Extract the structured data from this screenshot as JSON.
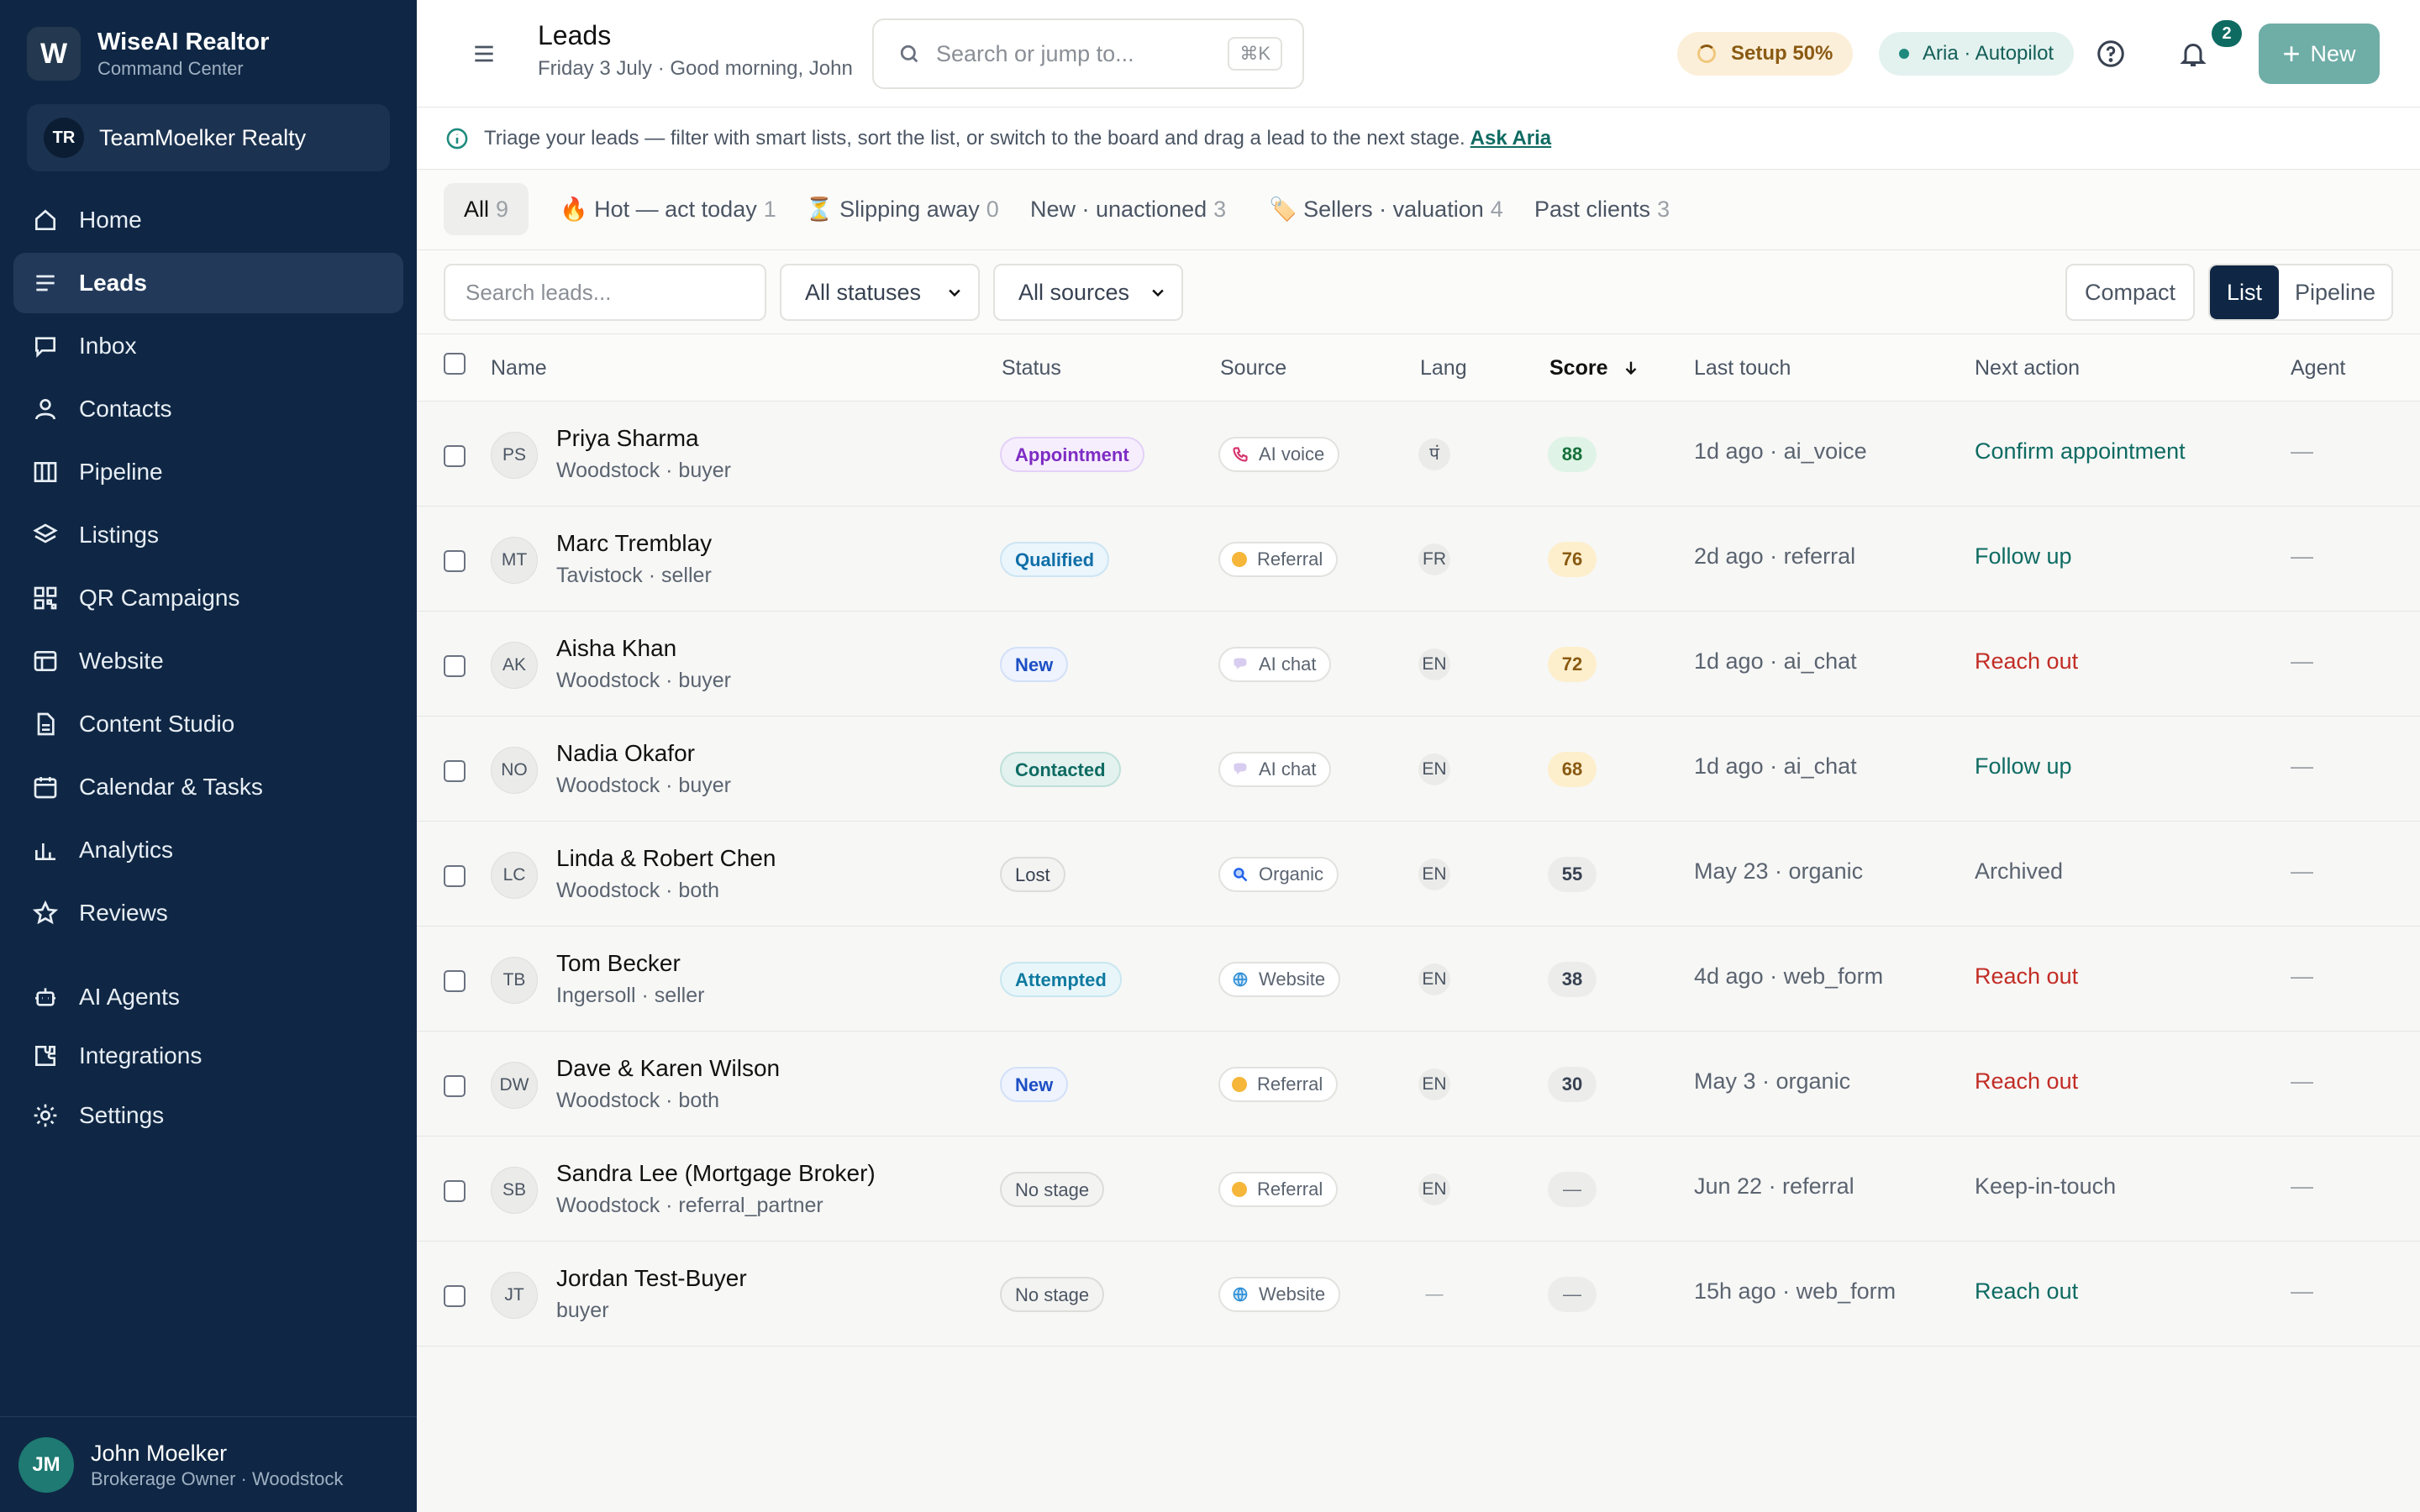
{
  "brand": {
    "logo_letter": "W",
    "name": "WiseAI Realtor",
    "subtitle": "Command Center"
  },
  "team": {
    "initials": "TR",
    "name": "TeamMoelker Realty"
  },
  "nav": [
    {
      "label": "Home",
      "icon": "home-icon"
    },
    {
      "label": "Leads",
      "icon": "list-icon",
      "active": true
    },
    {
      "label": "Inbox",
      "icon": "chat-icon"
    },
    {
      "label": "Contacts",
      "icon": "person-icon"
    },
    {
      "label": "Pipeline",
      "icon": "columns-icon"
    },
    {
      "label": "Listings",
      "icon": "layers-icon"
    },
    {
      "label": "QR Campaigns",
      "icon": "qr-icon"
    },
    {
      "label": "Website",
      "icon": "browser-icon"
    },
    {
      "label": "Content Studio",
      "icon": "document-icon"
    },
    {
      "label": "Calendar & Tasks",
      "icon": "calendar-icon"
    },
    {
      "label": "Analytics",
      "icon": "bar-chart-icon"
    },
    {
      "label": "Reviews",
      "icon": "star-icon"
    },
    {
      "label": "AI Agents",
      "icon": "robot-icon"
    },
    {
      "label": "Integrations",
      "icon": "puzzle-icon"
    },
    {
      "label": "Settings",
      "icon": "gear-icon"
    }
  ],
  "user": {
    "initials": "JM",
    "name": "John Moelker",
    "role": "Brokerage Owner · Woodstock"
  },
  "header": {
    "title": "Leads",
    "subtitle": "Friday 3 July · Good morning, John",
    "search_placeholder": "Search or jump to...",
    "search_shortcut": "⌘K",
    "setup_label": "Setup 50%",
    "aria_label": "Aria · Autopilot",
    "notification_count": "2",
    "new_label": "New"
  },
  "info": {
    "text": "Triage your leads — filter with smart lists, sort the list, or switch to the board and drag a lead to the next stage.",
    "link": "Ask Aria"
  },
  "smart_lists": [
    {
      "label": "All",
      "count": "9",
      "active": true
    },
    {
      "label": "🔥 Hot — act today",
      "count": "1"
    },
    {
      "label": "⏳ Slipping away",
      "count": "0"
    },
    {
      "label": "New · unactioned",
      "count": "3"
    },
    {
      "label": "🏷️ Sellers · valuation",
      "count": "4"
    },
    {
      "label": "Past clients",
      "count": "3"
    }
  ],
  "filters": {
    "search_placeholder": "Search leads...",
    "status_select": "All statuses",
    "source_select": "All sources",
    "compact_label": "Compact",
    "view_list": "List",
    "view_pipeline": "Pipeline"
  },
  "columns": {
    "name": "Name",
    "status": "Status",
    "source": "Source",
    "lang": "Lang",
    "score": "Score",
    "last_touch": "Last touch",
    "next_action": "Next action",
    "agent": "Agent"
  },
  "sort": {
    "column": "Score",
    "direction": "descending"
  },
  "rows": [
    {
      "initials": "PS",
      "name": "Priya Sharma",
      "meta": "Woodstock · buyer",
      "status": "Appointment",
      "status_style": "appointment",
      "source": "AI voice",
      "source_icon": "phone-icon",
      "lang": "पं",
      "score": "88",
      "score_style": "green",
      "last_touch": "1d ago · ai_voice",
      "next_action": "Confirm appointment",
      "action_style": "green",
      "agent": "—"
    },
    {
      "initials": "MT",
      "name": "Marc Tremblay",
      "meta": "Tavistock · seller",
      "status": "Qualified",
      "status_style": "qualified",
      "source": "Referral",
      "source_icon": "handshake-icon",
      "lang": "FR",
      "score": "76",
      "score_style": "amber",
      "last_touch": "2d ago · referral",
      "next_action": "Follow up",
      "action_style": "green",
      "agent": "—"
    },
    {
      "initials": "AK",
      "name": "Aisha Khan",
      "meta": "Woodstock · buyer",
      "status": "New",
      "status_style": "new",
      "source": "AI chat",
      "source_icon": "speech-bubble-icon",
      "lang": "EN",
      "score": "72",
      "score_style": "amber",
      "last_touch": "1d ago · ai_chat",
      "next_action": "Reach out",
      "action_style": "red",
      "agent": "—"
    },
    {
      "initials": "NO",
      "name": "Nadia Okafor",
      "meta": "Woodstock · buyer",
      "status": "Contacted",
      "status_style": "contacted",
      "source": "AI chat",
      "source_icon": "speech-bubble-icon",
      "lang": "EN",
      "score": "68",
      "score_style": "amber",
      "last_touch": "1d ago · ai_chat",
      "next_action": "Follow up",
      "action_style": "green",
      "agent": "—"
    },
    {
      "initials": "LC",
      "name": "Linda & Robert Chen",
      "meta": "Woodstock · both",
      "status": "Lost",
      "status_style": "lost",
      "source": "Organic",
      "source_icon": "magnifier-icon",
      "lang": "EN",
      "score": "55",
      "score_style": "grey",
      "last_touch": "May 23 · organic",
      "next_action": "Archived",
      "action_style": "grey",
      "agent": "—"
    },
    {
      "initials": "TB",
      "name": "Tom Becker",
      "meta": "Ingersoll · seller",
      "status": "Attempted",
      "status_style": "attempted",
      "source": "Website",
      "source_icon": "globe-icon",
      "lang": "EN",
      "score": "38",
      "score_style": "grey",
      "last_touch": "4d ago · web_form",
      "next_action": "Reach out",
      "action_style": "red",
      "agent": "—"
    },
    {
      "initials": "DW",
      "name": "Dave & Karen Wilson",
      "meta": "Woodstock · both",
      "status": "New",
      "status_style": "new",
      "source": "Referral",
      "source_icon": "handshake-icon",
      "lang": "EN",
      "score": "30",
      "score_style": "grey",
      "last_touch": "May 3 · organic",
      "next_action": "Reach out",
      "action_style": "red",
      "agent": "—"
    },
    {
      "initials": "SB",
      "name": "Sandra Lee (Mortgage Broker)",
      "meta": "Woodstock · referral_partner",
      "status": "No stage",
      "status_style": "nostage",
      "source": "Referral",
      "source_icon": "handshake-icon",
      "lang": "EN",
      "score": "—",
      "score_style": "none",
      "last_touch": "Jun 22 · referral",
      "next_action": "Keep-in-touch",
      "action_style": "grey",
      "agent": "—"
    },
    {
      "initials": "JT",
      "name": "Jordan Test-Buyer",
      "meta": "buyer",
      "status": "No stage",
      "status_style": "nostage",
      "source": "Website",
      "source_icon": "globe-icon",
      "lang": "—",
      "score": "—",
      "score_style": "none",
      "last_touch": "15h ago · web_form",
      "next_action": "Reach out",
      "action_style": "green",
      "agent": "—"
    }
  ],
  "colors": {
    "sidebar": "#0f2744",
    "accent": "#0e6b62",
    "new_button": "#6fada7",
    "danger": "#c22d25"
  }
}
